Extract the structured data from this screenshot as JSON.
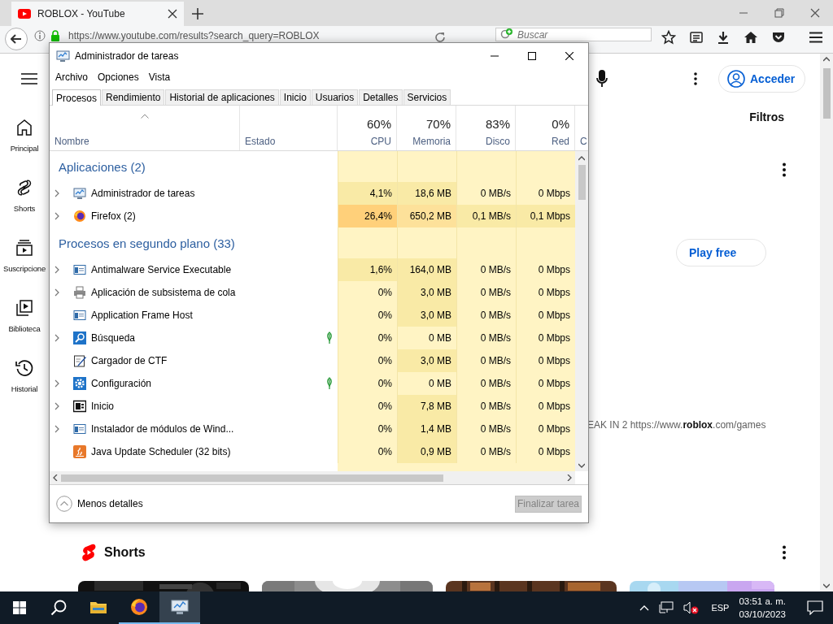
{
  "browser": {
    "tab": {
      "title": "ROBLOX - YouTube"
    },
    "url": "https://www.youtube.com/results?search_query=ROBLOX",
    "search": {
      "placeholder": "Buscar"
    }
  },
  "youtube": {
    "sidebar": [
      {
        "label": "Principal",
        "kind": "home"
      },
      {
        "label": "Shorts",
        "kind": "shorts"
      },
      {
        "label": "Suscripcione",
        "kind": "subscriptions"
      },
      {
        "label": "Biblioteca",
        "kind": "library"
      },
      {
        "label": "Historial",
        "kind": "history"
      }
    ],
    "sign_in": "Acceder",
    "filters": "Filtros",
    "play_button": "Play free",
    "description": "EAK IN 2 https://www.**roblox**.com/games",
    "shorts_title": "Shorts"
  },
  "task_manager": {
    "title": "Administrador de tareas",
    "menu": [
      "Archivo",
      "Opciones",
      "Vista"
    ],
    "tabs": [
      {
        "label": "Procesos",
        "selected": true
      },
      {
        "label": "Rendimiento",
        "selected": false
      },
      {
        "label": "Historial de aplicaciones",
        "selected": false
      },
      {
        "label": "Inicio",
        "selected": false
      },
      {
        "label": "Usuarios",
        "selected": false
      },
      {
        "label": "Detalles",
        "selected": false
      },
      {
        "label": "Servicios",
        "selected": false
      }
    ],
    "columns": [
      {
        "label": "Nombre"
      },
      {
        "label": "Estado"
      },
      {
        "label": "CPU",
        "usage": "60%"
      },
      {
        "label": "Memoria",
        "usage": "70%"
      },
      {
        "label": "Disco",
        "usage": "83%"
      },
      {
        "label": "Red",
        "usage": "0%"
      },
      {
        "label": "C"
      }
    ],
    "groups": [
      {
        "title": "Aplicaciones (2)",
        "rows": [
          {
            "name": "Administrador de tareas",
            "kind": "monitor",
            "expandable": true,
            "suspended": false,
            "cpu": {
              "text": "4,1%",
              "color": "#f9eaa6"
            },
            "memory": {
              "text": "18,6 MB",
              "color": "#f9eaa6"
            },
            "disk": {
              "text": "0 MB/s",
              "color": "#fff4c4"
            },
            "network": {
              "text": "0 Mbps",
              "color": "#fff4c4"
            }
          },
          {
            "name": "Firefox (2)",
            "kind": "firefox",
            "expandable": true,
            "suspended": false,
            "cpu": {
              "text": "26,4%",
              "color": "#ffd07a"
            },
            "memory": {
              "text": "650,2 MB",
              "color": "#fde19a"
            },
            "disk": {
              "text": "0,1 MB/s",
              "color": "#f9eaa6"
            },
            "network": {
              "text": "0,1 Mbps",
              "color": "#f9eaa6"
            }
          }
        ]
      },
      {
        "title": "Procesos en segundo plano (33)",
        "rows": [
          {
            "name": "Antimalware Service Executable",
            "kind": "window",
            "expandable": true,
            "suspended": false,
            "cpu": {
              "text": "1,6%",
              "color": "#f9eaa6"
            },
            "memory": {
              "text": "164,0 MB",
              "color": "#f9eaa6"
            },
            "disk": {
              "text": "0 MB/s",
              "color": "#fff4c4"
            },
            "network": {
              "text": "0 Mbps",
              "color": "#fff4c4"
            }
          },
          {
            "name": "Aplicación de subsistema de cola",
            "kind": "printer",
            "expandable": true,
            "suspended": false,
            "cpu": {
              "text": "0%",
              "color": "#fff4c4"
            },
            "memory": {
              "text": "3,0 MB",
              "color": "#f9eaa6"
            },
            "disk": {
              "text": "0 MB/s",
              "color": "#fff4c4"
            },
            "network": {
              "text": "0 Mbps",
              "color": "#fff4c4"
            }
          },
          {
            "name": "Application Frame Host",
            "kind": "window",
            "expandable": false,
            "suspended": false,
            "cpu": {
              "text": "0%",
              "color": "#fff4c4"
            },
            "memory": {
              "text": "3,0 MB",
              "color": "#f9eaa6"
            },
            "disk": {
              "text": "0 MB/s",
              "color": "#fff4c4"
            },
            "network": {
              "text": "0 Mbps",
              "color": "#fff4c4"
            }
          },
          {
            "name": "Búsqueda",
            "kind": "search",
            "expandable": true,
            "suspended": true,
            "cpu": {
              "text": "0%",
              "color": "#fff4c4"
            },
            "memory": {
              "text": "0 MB",
              "color": "#fff4c4"
            },
            "disk": {
              "text": "0 MB/s",
              "color": "#fff4c4"
            },
            "network": {
              "text": "0 Mbps",
              "color": "#fff4c4"
            }
          },
          {
            "name": "Cargador de CTF",
            "kind": "pen",
            "expandable": false,
            "suspended": false,
            "cpu": {
              "text": "0%",
              "color": "#fff4c4"
            },
            "memory": {
              "text": "3,0 MB",
              "color": "#f9eaa6"
            },
            "disk": {
              "text": "0 MB/s",
              "color": "#fff4c4"
            },
            "network": {
              "text": "0 Mbps",
              "color": "#fff4c4"
            }
          },
          {
            "name": "Configuración",
            "kind": "gear",
            "expandable": true,
            "suspended": true,
            "cpu": {
              "text": "0%",
              "color": "#fff4c4"
            },
            "memory": {
              "text": "0 MB",
              "color": "#fff4c4"
            },
            "disk": {
              "text": "0 MB/s",
              "color": "#fff4c4"
            },
            "network": {
              "text": "0 Mbps",
              "color": "#fff4c4"
            }
          },
          {
            "name": "Inicio",
            "kind": "start",
            "expandable": true,
            "suspended": false,
            "cpu": {
              "text": "0%",
              "color": "#fff4c4"
            },
            "memory": {
              "text": "7,8 MB",
              "color": "#f9eaa6"
            },
            "disk": {
              "text": "0 MB/s",
              "color": "#fff4c4"
            },
            "network": {
              "text": "0 Mbps",
              "color": "#fff4c4"
            }
          },
          {
            "name": "Instalador de módulos de Wind...",
            "kind": "window",
            "expandable": true,
            "suspended": false,
            "cpu": {
              "text": "0%",
              "color": "#fff4c4"
            },
            "memory": {
              "text": "1,4 MB",
              "color": "#f9eaa6"
            },
            "disk": {
              "text": "0 MB/s",
              "color": "#fff4c4"
            },
            "network": {
              "text": "0 Mbps",
              "color": "#fff4c4"
            }
          },
          {
            "name": "Java Update Scheduler (32 bits)",
            "kind": "java",
            "expandable": false,
            "suspended": false,
            "cpu": {
              "text": "0%",
              "color": "#fff4c4"
            },
            "memory": {
              "text": "0,9 MB",
              "color": "#f9eaa6"
            },
            "disk": {
              "text": "0 MB/s",
              "color": "#fff4c4"
            },
            "network": {
              "text": "0 Mbps",
              "color": "#fff4c4"
            }
          }
        ]
      }
    ],
    "footer": {
      "toggle": "Menos detalles",
      "end_task": {
        "label": "Finalizar tarea",
        "disabled": true
      }
    }
  },
  "taskbar": {
    "apps": [
      {
        "kind": "explorer",
        "running": false,
        "active": false
      },
      {
        "kind": "firefox",
        "running": true,
        "active": false
      },
      {
        "kind": "monitor",
        "running": true,
        "active": true
      }
    ],
    "muted": true,
    "language": "ESP",
    "time": "03:51 a. m.",
    "date": "03/10/2023"
  }
}
